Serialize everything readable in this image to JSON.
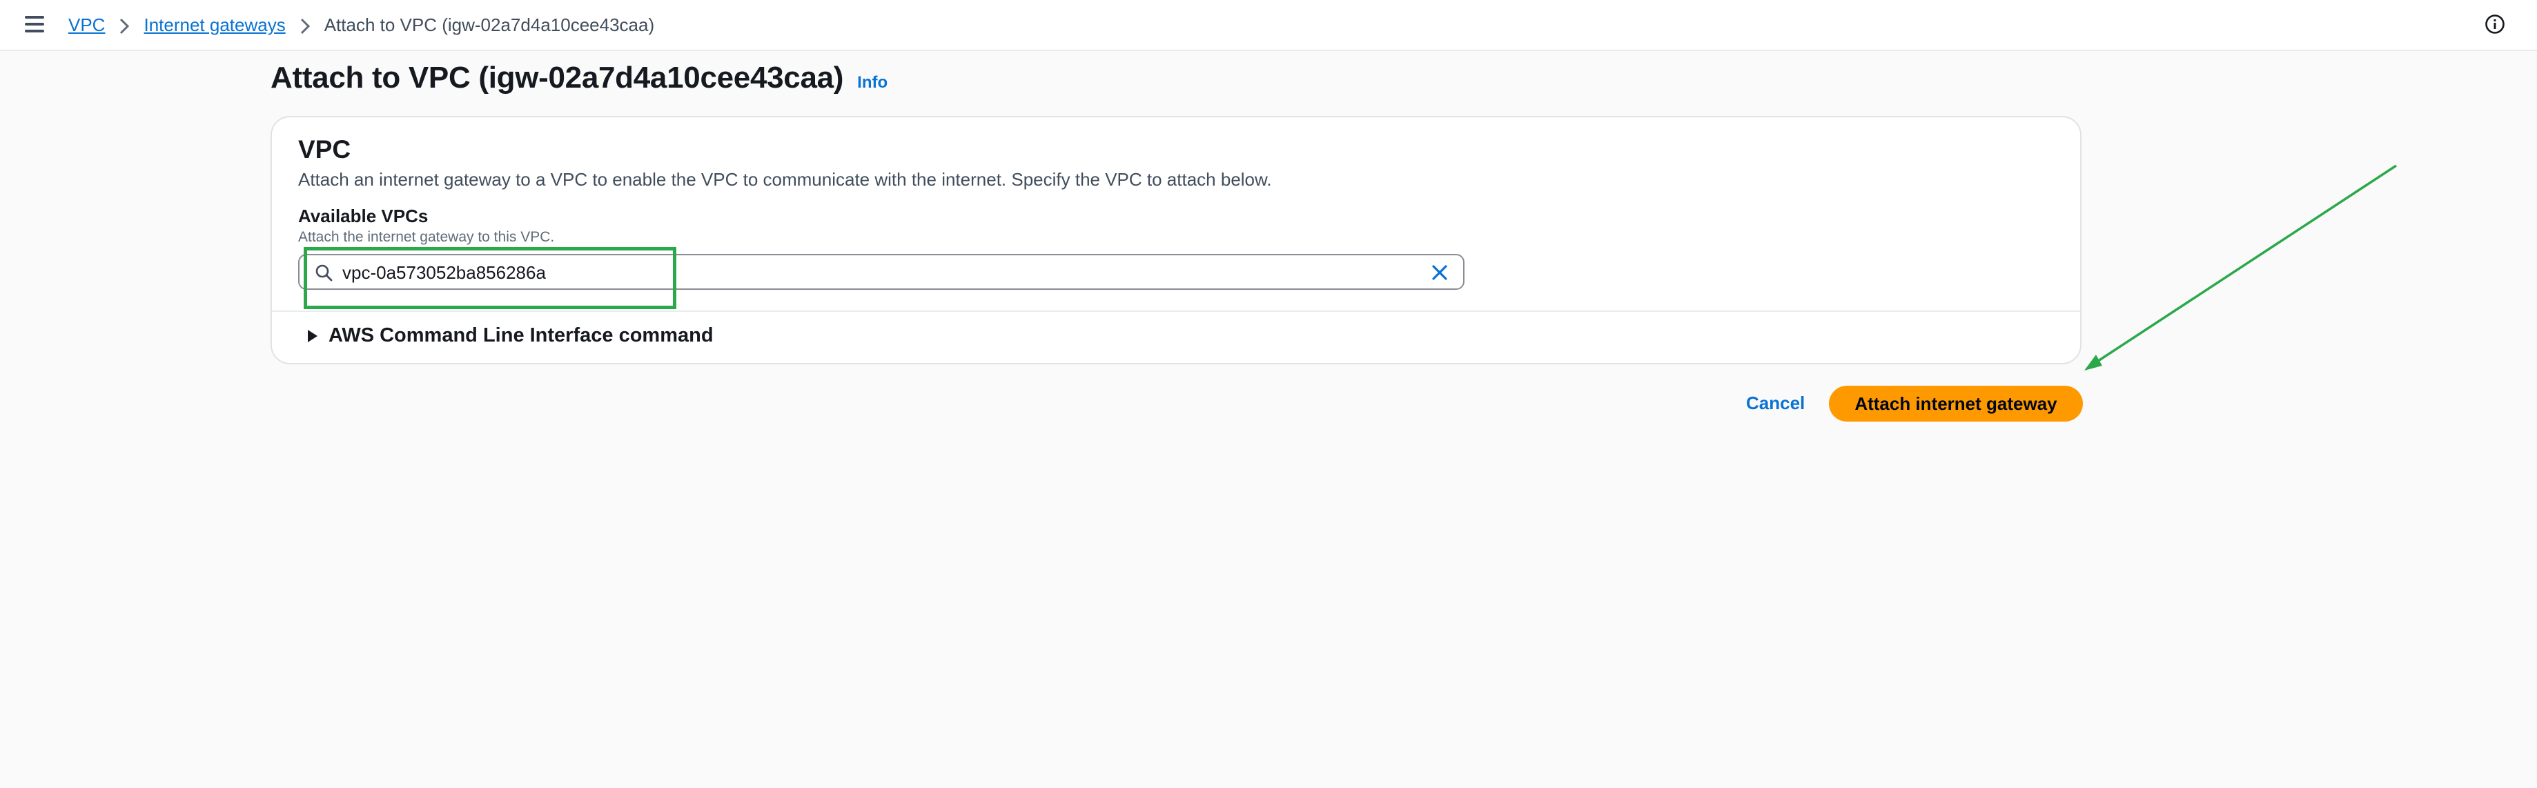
{
  "topbar": {
    "menu_icon": "hamburger-menu-icon",
    "info_icon": "info-circle-icon"
  },
  "breadcrumb": {
    "items": [
      "VPC",
      "Internet gateways",
      "Attach to VPC (igw-02a7d4a10cee43caa)"
    ],
    "separator_icon": "chevron-right-icon"
  },
  "page": {
    "title": "Attach to VPC (igw-02a7d4a10cee43caa)",
    "info_link": "Info"
  },
  "card": {
    "title": "VPC",
    "description": "Attach an internet gateway to a VPC to enable the VPC to communicate with the internet. Specify the VPC to attach below.",
    "field_label": "Available VPCs",
    "field_description": "Attach the internet gateway to this VPC.",
    "search_value": "vpc-0a573052ba856286a",
    "search_icon": "search-icon",
    "clear_icon": "close-icon",
    "expander_label": "AWS Command Line Interface command",
    "expander_icon": "caret-right-icon"
  },
  "actions": {
    "cancel_label": "Cancel",
    "submit_label": "Attach internet gateway"
  },
  "colors": {
    "link": "#0972d3",
    "primary_button": "#ff9900",
    "highlight": "#2ba84a",
    "annotation_arrow": "#2ba84a"
  }
}
